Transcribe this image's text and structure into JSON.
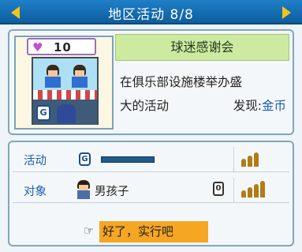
{
  "header": {
    "title": "地区活动 8/8",
    "prev_icon": "triangle-left",
    "next_icon": "triangle-right",
    "accent_color": "#f3c41a"
  },
  "card": {
    "likes": "10",
    "heart_icon": "heart",
    "name": "球迷感谢会",
    "description_line1": "在俱乐部设施楼举办盛",
    "description_line2": "大的活动",
    "discover_label": "发现:",
    "discover_value": "金币"
  },
  "details": {
    "activity_label": "活动",
    "activity_level": 3,
    "target_label": "对象",
    "target_value": "男孩子",
    "target_count": "0",
    "target_level": 4
  },
  "action": {
    "confirm_label": "好了，实行吧",
    "hand_icon": "pointing-hand"
  }
}
